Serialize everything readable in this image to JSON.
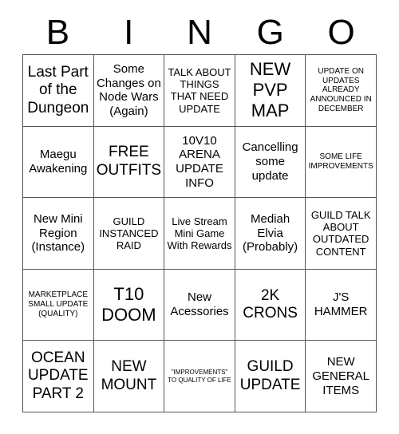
{
  "header": {
    "letters": [
      "B",
      "I",
      "N",
      "G",
      "O"
    ]
  },
  "colors": {
    "border": "#555555",
    "text": "#000000",
    "background": "#ffffff"
  },
  "grid": {
    "rows": [
      {
        "cells": [
          {
            "text": "Last Part of the Dungeon",
            "size": "s-lg"
          },
          {
            "text": "Some Changes on Node Wars (Again)",
            "size": "s-md"
          },
          {
            "text": "TALK ABOUT THINGS THAT NEED UPDATE",
            "size": "s-sm"
          },
          {
            "text": "NEW PVP MAP",
            "size": "s-xl"
          },
          {
            "text": "UPDATE ON UPDATES ALREADY ANNOUNCED IN DECEMBER",
            "size": "s-xs"
          }
        ]
      },
      {
        "cells": [
          {
            "text": "Maegu Awakening",
            "size": "s-md"
          },
          {
            "text": "FREE OUTFITS",
            "size": "s-lg"
          },
          {
            "text": "10V10 ARENA UPDATE INFO",
            "size": "s-md"
          },
          {
            "text": "Cancelling some update",
            "size": "s-md"
          },
          {
            "text": "SOME LIFE IMPROVEMENTS",
            "size": "s-xs"
          }
        ]
      },
      {
        "cells": [
          {
            "text": "New Mini Region (Instance)",
            "size": "s-md"
          },
          {
            "text": "GUILD INSTANCED RAID",
            "size": "s-sm"
          },
          {
            "text": "Live Stream Mini Game With Rewards",
            "size": "s-sm"
          },
          {
            "text": "Mediah Elvia (Probably)",
            "size": "s-md"
          },
          {
            "text": "GUILD TALK ABOUT OUTDATED CONTENT",
            "size": "s-sm"
          }
        ]
      },
      {
        "cells": [
          {
            "text": "MARKETPLACE SMALL UPDATE (QUALITY)",
            "size": "s-xs"
          },
          {
            "text": "T10 DOOM",
            "size": "s-xl"
          },
          {
            "text": "New Acessories",
            "size": "s-md"
          },
          {
            "text": "2K CRONS",
            "size": "s-lg"
          },
          {
            "text": "J'S HAMMER",
            "size": "s-md"
          }
        ]
      },
      {
        "cells": [
          {
            "text": "OCEAN UPDATE PART 2",
            "size": "s-lg"
          },
          {
            "text": "NEW MOUNT",
            "size": "s-lg"
          },
          {
            "text": "\"IMPROVEMENTS\" TO QUALITY OF LIFE",
            "size": "s-xxs"
          },
          {
            "text": "GUILD UPDATE",
            "size": "s-lg"
          },
          {
            "text": "NEW GENERAL ITEMS",
            "size": "s-md"
          }
        ]
      }
    ]
  }
}
